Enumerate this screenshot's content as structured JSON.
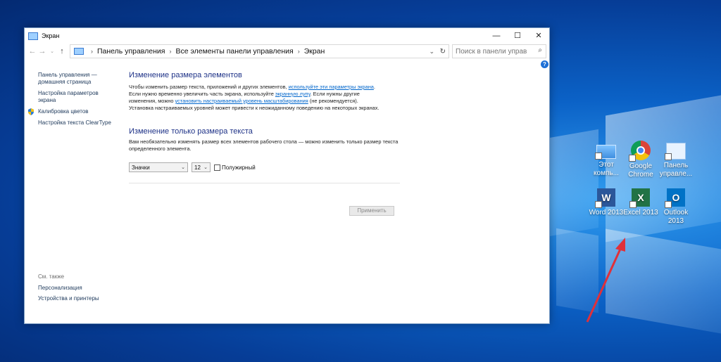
{
  "window": {
    "title": "Экран",
    "controls": {
      "minimize": "—",
      "maximize": "☐",
      "close": "✕"
    }
  },
  "address": {
    "crumbs": [
      "Панель управления",
      "Все элементы панели управления",
      "Экран"
    ],
    "search_placeholder": "Поиск в панели управ"
  },
  "sidebar": {
    "items": [
      {
        "label": "Панель управления —\nдомашняя страница"
      },
      {
        "label": "Настройка параметров\nэкрана"
      },
      {
        "label": "Калибровка цветов"
      },
      {
        "label": "Настройка текста ClearType"
      }
    ],
    "see_also_title": "См. также",
    "see_also": [
      "Персонализация",
      "Устройства и принтеры"
    ]
  },
  "main": {
    "section1_title": "Изменение размера элементов",
    "p1_a": "Чтобы изменить размер текста, приложений и других элементов, ",
    "p1_link1": "используйте эти параметры экрана",
    "p1_b": ".",
    "p1_c": "Если нужно временно увеличить часть экрана, используйте ",
    "p1_link2": "экранную лупу",
    "p1_d": ". Если нужны другие",
    "p1_e": "изменения, можно ",
    "p1_link3": "установить настраиваемый уровень масштабирования",
    "p1_f": " (не рекомендуется).",
    "p1_g": "Установка настраиваемых уровней может привести к неожиданному поведению на некоторых экранах.",
    "section2_title": "Изменение только размера текста",
    "p2": "Вам необязательно изменять размер всех элементов рабочего стола — можно изменить только размер текста определенного элемента.",
    "element_select": "Значки",
    "size_select": "12",
    "bold_label": "Полужирный",
    "apply_button": "Применить"
  },
  "desktop_icons": [
    {
      "label": "Этот компь...",
      "icon": "pc-icon"
    },
    {
      "label": "Google Chrome",
      "icon": "chrome-icon"
    },
    {
      "label": "Панель управле...",
      "icon": "control-panel-icon"
    },
    {
      "label": "Word 2013",
      "icon": "word-icon"
    },
    {
      "label": "Excel 2013",
      "icon": "excel-icon"
    },
    {
      "label": "Outlook 2013",
      "icon": "outlook-icon"
    }
  ],
  "colors": {
    "accent": "#1e3287",
    "link": "#0066cc",
    "arrow": "#e0303a"
  }
}
